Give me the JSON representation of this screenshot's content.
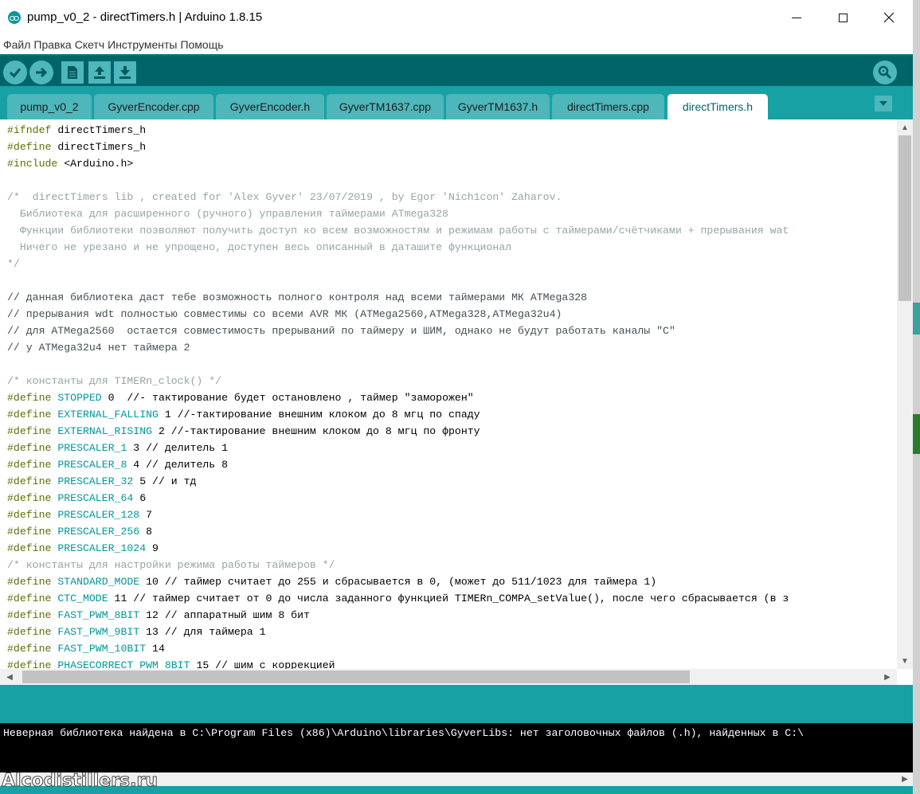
{
  "window": {
    "title": "pump_v0_2 - directTimers.h | Arduino 1.8.15",
    "minimize_label": "—",
    "maximize_label": "☐",
    "close_label": "✕"
  },
  "menu": [
    "Файл",
    "Правка",
    "Скетч",
    "Инструменты",
    "Помощь"
  ],
  "toolbar": {
    "icons": [
      "verify-icon",
      "upload-icon",
      "new-icon",
      "open-icon",
      "save-icon",
      "serial-monitor-icon"
    ]
  },
  "tabs": [
    {
      "label": "pump_v0_2",
      "active": false
    },
    {
      "label": "GyverEncoder.cpp",
      "active": false
    },
    {
      "label": "GyverEncoder.h",
      "active": false
    },
    {
      "label": "GyverTM1637.cpp",
      "active": false
    },
    {
      "label": "GyverTM1637.h",
      "active": false
    },
    {
      "label": "directTimers.cpp",
      "active": false
    },
    {
      "label": "directTimers.h",
      "active": true
    }
  ],
  "code_lines": [
    [
      [
        "pre",
        "#ifndef"
      ],
      [
        "plain",
        " directTimers_h"
      ]
    ],
    [
      [
        "pre",
        "#define"
      ],
      [
        "plain",
        " directTimers_h"
      ]
    ],
    [
      [
        "pre",
        "#include"
      ],
      [
        "plain",
        " <Arduino.h>"
      ]
    ],
    [],
    [
      [
        "comment",
        "/*  directTimers lib , created for 'Alex Gyver' 23/07/2019 , by Egor 'Nich1con' Zaharov."
      ]
    ],
    [
      [
        "comment",
        "  Библиотека для расширенного (ручного) управления таймерами ATmega328"
      ]
    ],
    [
      [
        "comment",
        "  Функции библиотеки позволяют получить доступ ко всем возможностям и режимам работы с таймерами/счётчиками + прерывания wat"
      ]
    ],
    [
      [
        "comment",
        "  Ничего не урезано и не упрощено, доступен весь описанный в даташите функционал"
      ]
    ],
    [
      [
        "comment",
        "*/"
      ]
    ],
    [],
    [
      [
        "lc",
        "// данная библиотека даст тебе возможность полного контроля над всеми таймерами МК ATMega328"
      ]
    ],
    [
      [
        "lc",
        "// прерывания wdt полностью совместимы со всеми AVR МК (ATMega2560,ATMega328,ATMega32u4)"
      ]
    ],
    [
      [
        "lc",
        "// для ATMega2560  остается совместимость прерываний по таймеру и ШИМ, однако не будут работать каналы \"С\""
      ]
    ],
    [
      [
        "lc",
        "// у ATMega32u4 нет таймера 2"
      ]
    ],
    [],
    [
      [
        "comment",
        "/* константы для TIMERn_clock() */"
      ]
    ],
    [
      [
        "pre",
        "#define"
      ],
      [
        "plain",
        " "
      ],
      [
        "const",
        "STOPPED"
      ],
      [
        "plain",
        " 0  //- тактирование будет остановлено , таймер \"заморожен\""
      ]
    ],
    [
      [
        "pre",
        "#define"
      ],
      [
        "plain",
        " "
      ],
      [
        "const",
        "EXTERNAL_FALLING"
      ],
      [
        "plain",
        " 1 //-тактирование внешним клоком до 8 мгц по спаду"
      ]
    ],
    [
      [
        "pre",
        "#define"
      ],
      [
        "plain",
        " "
      ],
      [
        "const",
        "EXTERNAL_RISING"
      ],
      [
        "plain",
        " 2 //-тактирование внешним клоком до 8 мгц по фронту"
      ]
    ],
    [
      [
        "pre",
        "#define"
      ],
      [
        "plain",
        " "
      ],
      [
        "const",
        "PRESCALER_1"
      ],
      [
        "plain",
        " 3 // делитель 1"
      ]
    ],
    [
      [
        "pre",
        "#define"
      ],
      [
        "plain",
        " "
      ],
      [
        "const",
        "PRESCALER_8"
      ],
      [
        "plain",
        " 4 // делитель 8"
      ]
    ],
    [
      [
        "pre",
        "#define"
      ],
      [
        "plain",
        " "
      ],
      [
        "const",
        "PRESCALER_32"
      ],
      [
        "plain",
        " 5 // и тд"
      ]
    ],
    [
      [
        "pre",
        "#define"
      ],
      [
        "plain",
        " "
      ],
      [
        "const",
        "PRESCALER_64"
      ],
      [
        "plain",
        " 6"
      ]
    ],
    [
      [
        "pre",
        "#define"
      ],
      [
        "plain",
        " "
      ],
      [
        "const",
        "PRESCALER_128"
      ],
      [
        "plain",
        " 7"
      ]
    ],
    [
      [
        "pre",
        "#define"
      ],
      [
        "plain",
        " "
      ],
      [
        "const",
        "PRESCALER_256"
      ],
      [
        "plain",
        " 8"
      ]
    ],
    [
      [
        "pre",
        "#define"
      ],
      [
        "plain",
        " "
      ],
      [
        "const",
        "PRESCALER_1024"
      ],
      [
        "plain",
        " 9"
      ]
    ],
    [
      [
        "comment",
        "/* константы для настройки режима работы таймеров */"
      ]
    ],
    [
      [
        "pre",
        "#define"
      ],
      [
        "plain",
        " "
      ],
      [
        "const",
        "STANDARD_MODE"
      ],
      [
        "plain",
        " 10 // таймер считает до 255 и сбрасывается в 0, (может до 511/1023 для таймера 1)"
      ]
    ],
    [
      [
        "pre",
        "#define"
      ],
      [
        "plain",
        " "
      ],
      [
        "const",
        "CTC_MODE"
      ],
      [
        "plain",
        " 11 // таймер считает от 0 до числа заданного функцией TIMERn_COMPA_setValue(), после чего сбрасывается (в з"
      ]
    ],
    [
      [
        "pre",
        "#define"
      ],
      [
        "plain",
        " "
      ],
      [
        "const",
        "FAST_PWM_8BIT"
      ],
      [
        "plain",
        " 12 // аппаратный шим 8 бит"
      ]
    ],
    [
      [
        "pre",
        "#define"
      ],
      [
        "plain",
        " "
      ],
      [
        "const",
        "FAST_PWM_9BIT"
      ],
      [
        "plain",
        " 13 // для таймера 1"
      ]
    ],
    [
      [
        "pre",
        "#define"
      ],
      [
        "plain",
        " "
      ],
      [
        "const",
        "FAST_PWM_10BIT"
      ],
      [
        "plain",
        " 14"
      ]
    ],
    [
      [
        "pre",
        "#define"
      ],
      [
        "plain",
        " "
      ],
      [
        "const",
        "PHASECORRECT_PWM_8BIT"
      ],
      [
        "plain",
        " 15 // шим с коррекцией"
      ]
    ]
  ],
  "console": {
    "message": "Неверная библиотека найдена в C:\\Program Files (x86)\\Arduino\\libraries\\GyverLibs: нет заголовочных файлов (.h), найденных в C:\\"
  },
  "watermark": "Alcodistillers.ru",
  "colors": {
    "toolbar": "#006468",
    "tabbar": "#17a1a5",
    "tab": "#4db7bb",
    "preprocessor": "#5e6d03",
    "constant": "#00979c",
    "comment": "#95a5a6"
  }
}
